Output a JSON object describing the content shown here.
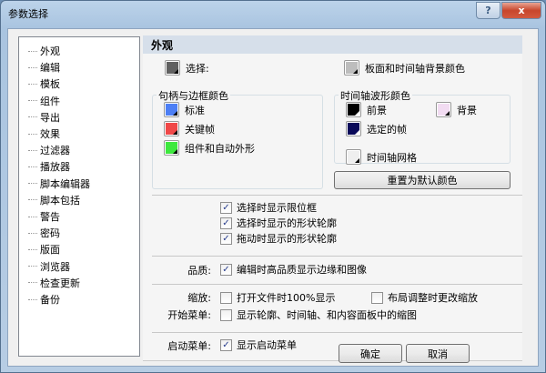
{
  "window": {
    "title": "参数选择",
    "help": "?",
    "close": "x"
  },
  "tree": [
    "外观",
    "编辑",
    "模板",
    "组件",
    "导出",
    "效果",
    "过滤器",
    "播放器",
    "脚本编辑器",
    "脚本包括",
    "警告",
    "密码",
    "版面",
    "浏览器",
    "检查更新",
    "备份"
  ],
  "section_title": "外观",
  "colors": {
    "select": {
      "label": "选择:",
      "color": "#606060"
    },
    "panel_bg": {
      "label": "板面和时间轴背景颜色",
      "color": "#bdbdbd"
    },
    "handle_group": "句柄与边框颜色",
    "standard": {
      "label": "标准",
      "color": "#4d7ff5"
    },
    "keyframe": {
      "label": "关键帧",
      "color": "#f04848"
    },
    "component": {
      "label": "组件和自动外形",
      "color": "#3ee83e"
    },
    "wave_group": "时间轴波形颜色",
    "foreground": {
      "label": "前景",
      "color": "#000000"
    },
    "background": {
      "label": "背景",
      "color": "#f2dcf2"
    },
    "selected_frame": {
      "label": "选定的帧",
      "color": "#0a0a5a"
    },
    "grid": {
      "label": "时间轴网格",
      "color": "#efefef"
    },
    "reset": "重置为默认颜色"
  },
  "checks": [
    {
      "label": "选择时显示限位框",
      "checked": true
    },
    {
      "label": "选择时显示的形状轮廓",
      "checked": true
    },
    {
      "label": "拖动时显示的形状轮廓",
      "checked": true
    }
  ],
  "quality": {
    "label": "品质:",
    "option": "编辑时高品质显示边缘和图像",
    "checked": true
  },
  "zoom": {
    "label": "缩放:",
    "option1": "打开文件时100%显示",
    "option2": "布局调整时更改缩放",
    "checked1": false,
    "checked2": false
  },
  "start_menu": {
    "label": "开始菜单:",
    "option": "显示轮廓、时间轴、和内容面板中的缩图",
    "checked": false
  },
  "launch_menu": {
    "label": "启动菜单:",
    "option": "显示启动菜单",
    "checked": true
  },
  "buttons": {
    "ok": "确定",
    "cancel": "取消"
  }
}
